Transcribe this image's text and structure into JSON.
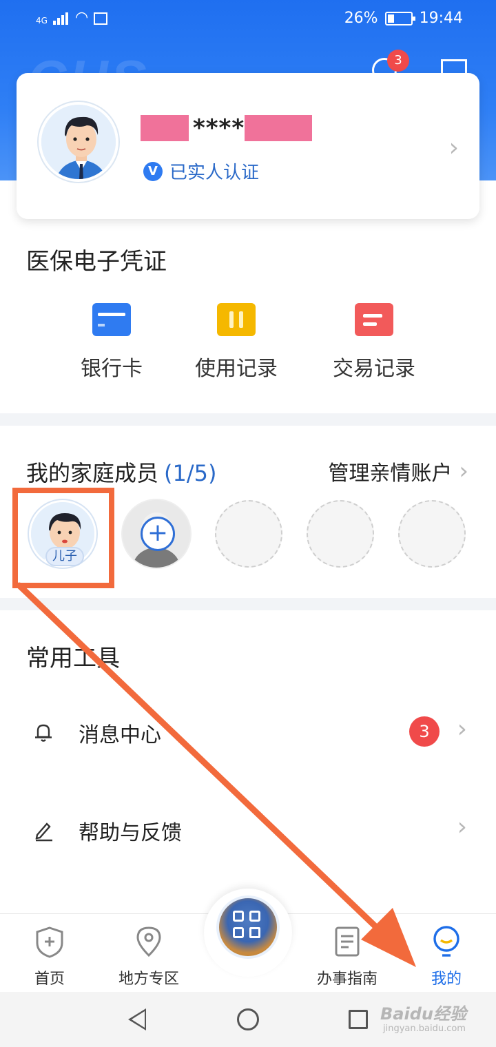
{
  "status_bar": {
    "network": "4G",
    "battery_percent": "26%",
    "time": "19:44"
  },
  "header": {
    "message_badge": "3",
    "icons": [
      "message-icon",
      "scan-icon"
    ]
  },
  "profile": {
    "name_masked": "****",
    "verification_label": "已实人认证",
    "verify_mark": "V"
  },
  "voucher_section": {
    "title": "医保电子凭证",
    "items": [
      {
        "label": "银行卡",
        "icon": "bank-card-icon",
        "color": "#2f7bf1"
      },
      {
        "label": "使用记录",
        "icon": "usage-record-icon",
        "color": "#f5b800"
      },
      {
        "label": "交易记录",
        "icon": "transaction-record-icon",
        "color": "#f25a5a"
      }
    ]
  },
  "family_section": {
    "title": "我的家庭成员",
    "count": "(1/5)",
    "manage_label": "管理亲情账户",
    "members": [
      {
        "tag": "儿子"
      }
    ]
  },
  "tools_section": {
    "title": "常用工具",
    "items": [
      {
        "label": "消息中心",
        "icon": "bell-icon",
        "badge": "3"
      },
      {
        "label": "帮助与反馈",
        "icon": "pen-icon",
        "badge": ""
      }
    ]
  },
  "tabbar": {
    "tabs": [
      {
        "label": "首页",
        "icon": "shield-plus-icon",
        "active": false
      },
      {
        "label": "地方专区",
        "icon": "location-pin-icon",
        "active": false
      },
      {
        "label": "",
        "icon": "qr-code-icon",
        "active": false
      },
      {
        "label": "办事指南",
        "icon": "document-icon",
        "active": false
      },
      {
        "label": "我的",
        "icon": "smile-profile-icon",
        "active": true
      }
    ],
    "accent_color": "#1e6ee8"
  },
  "watermark": {
    "brand": "Baidu经验",
    "url": "jingyan.baidu.com"
  },
  "annotation": {
    "highlight_color": "#f26a3c"
  }
}
